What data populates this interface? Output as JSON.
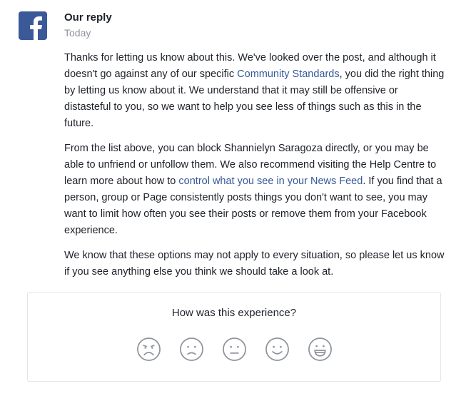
{
  "header": {
    "name": "Our reply",
    "time": "Today"
  },
  "message": {
    "p1_a": "Thanks for letting us know about this. We've looked over the post, and although it doesn't go against any of our specific ",
    "p1_link": "Community Standards",
    "p1_b": ", you did the right thing by letting us know about it. We understand that it may still be offensive or distasteful to you, so we want to help you see less of things such as this in the future.",
    "p2_a": "From the list above, you can block Shannielyn Saragoza directly, or you may be able to unfriend or unfollow them. We also recommend visiting the Help Centre to learn more about how to ",
    "p2_link": "control what you see in your News Feed",
    "p2_b": ". If you find that a person, group or Page consistently posts things you don't want to see, you may want to limit how often you see their posts or remove them from your Facebook experience.",
    "p3": "We know that these options may not apply to every situation, so please let us know if you see anything else you think we should take a look at."
  },
  "feedback": {
    "question": "How was this experience?",
    "faces": [
      "very-sad-face-icon",
      "sad-face-icon",
      "neutral-face-icon",
      "happy-face-icon",
      "very-happy-face-icon"
    ]
  },
  "colors": {
    "brand": "#3b5998",
    "link": "#365899",
    "muted": "#90949c",
    "face_stroke": "#90949c"
  },
  "icons": {
    "logo": "facebook-logo-icon"
  }
}
